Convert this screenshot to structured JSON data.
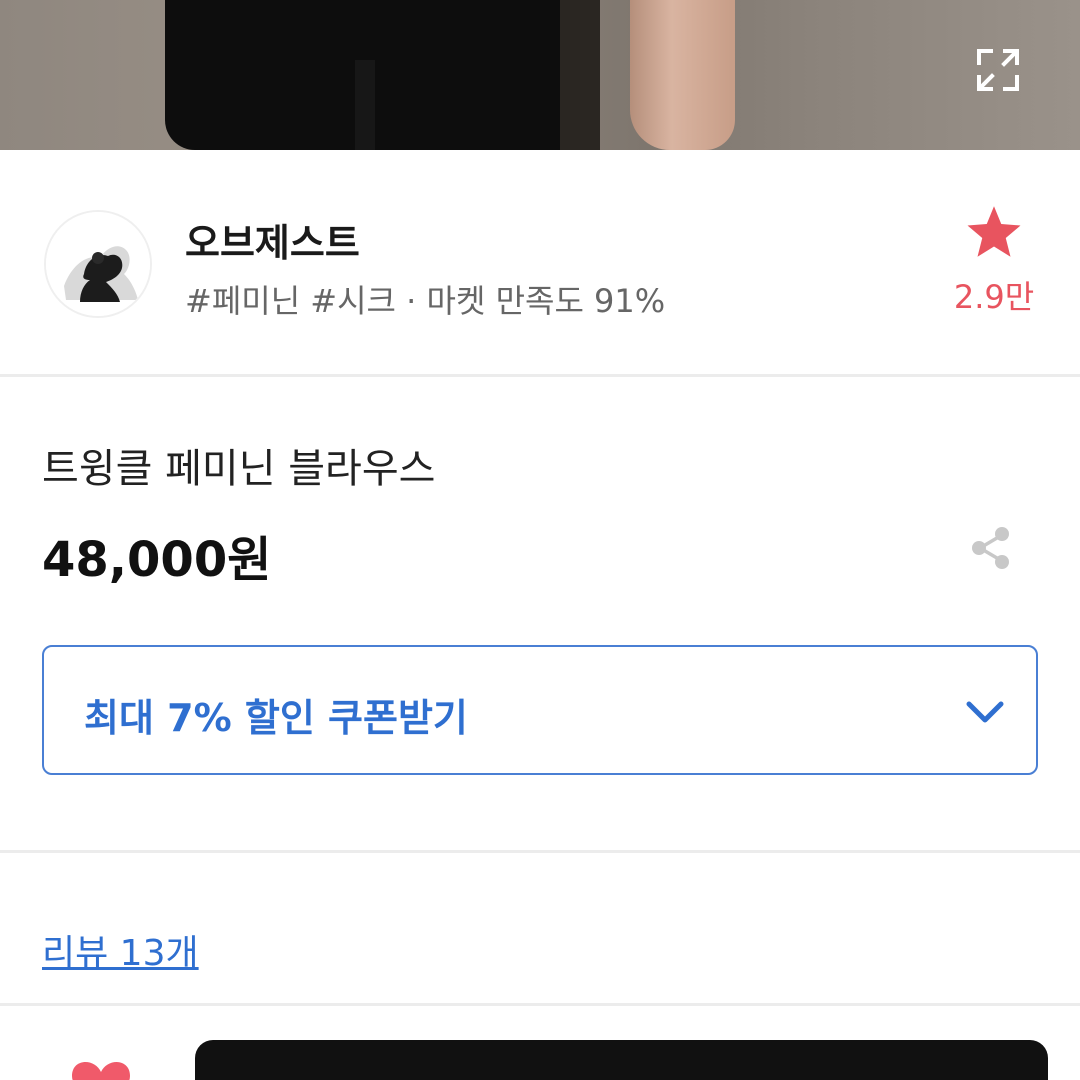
{
  "header": {
    "fullscreen_icon": "expand-icon"
  },
  "seller": {
    "name": "오브제스트",
    "tags": "#페미닌 #시크 · 마켓 만족도 91%",
    "favorite_count": "2.9만",
    "favorite_icon": "star-icon",
    "favorite_color": "#e8545f"
  },
  "product": {
    "title": "트윙클 페미닌 블라우스",
    "price": "48,000원",
    "share_icon": "share-icon"
  },
  "coupon": {
    "label": "최대 7% 할인 쿠폰받기",
    "icon": "chevron-down-icon",
    "accent": "#2f6fd0"
  },
  "reviews": {
    "link_label": "리뷰 13개"
  },
  "bottom_bar": {
    "like_icon": "heart-icon",
    "like_color": "#f05a6a"
  }
}
